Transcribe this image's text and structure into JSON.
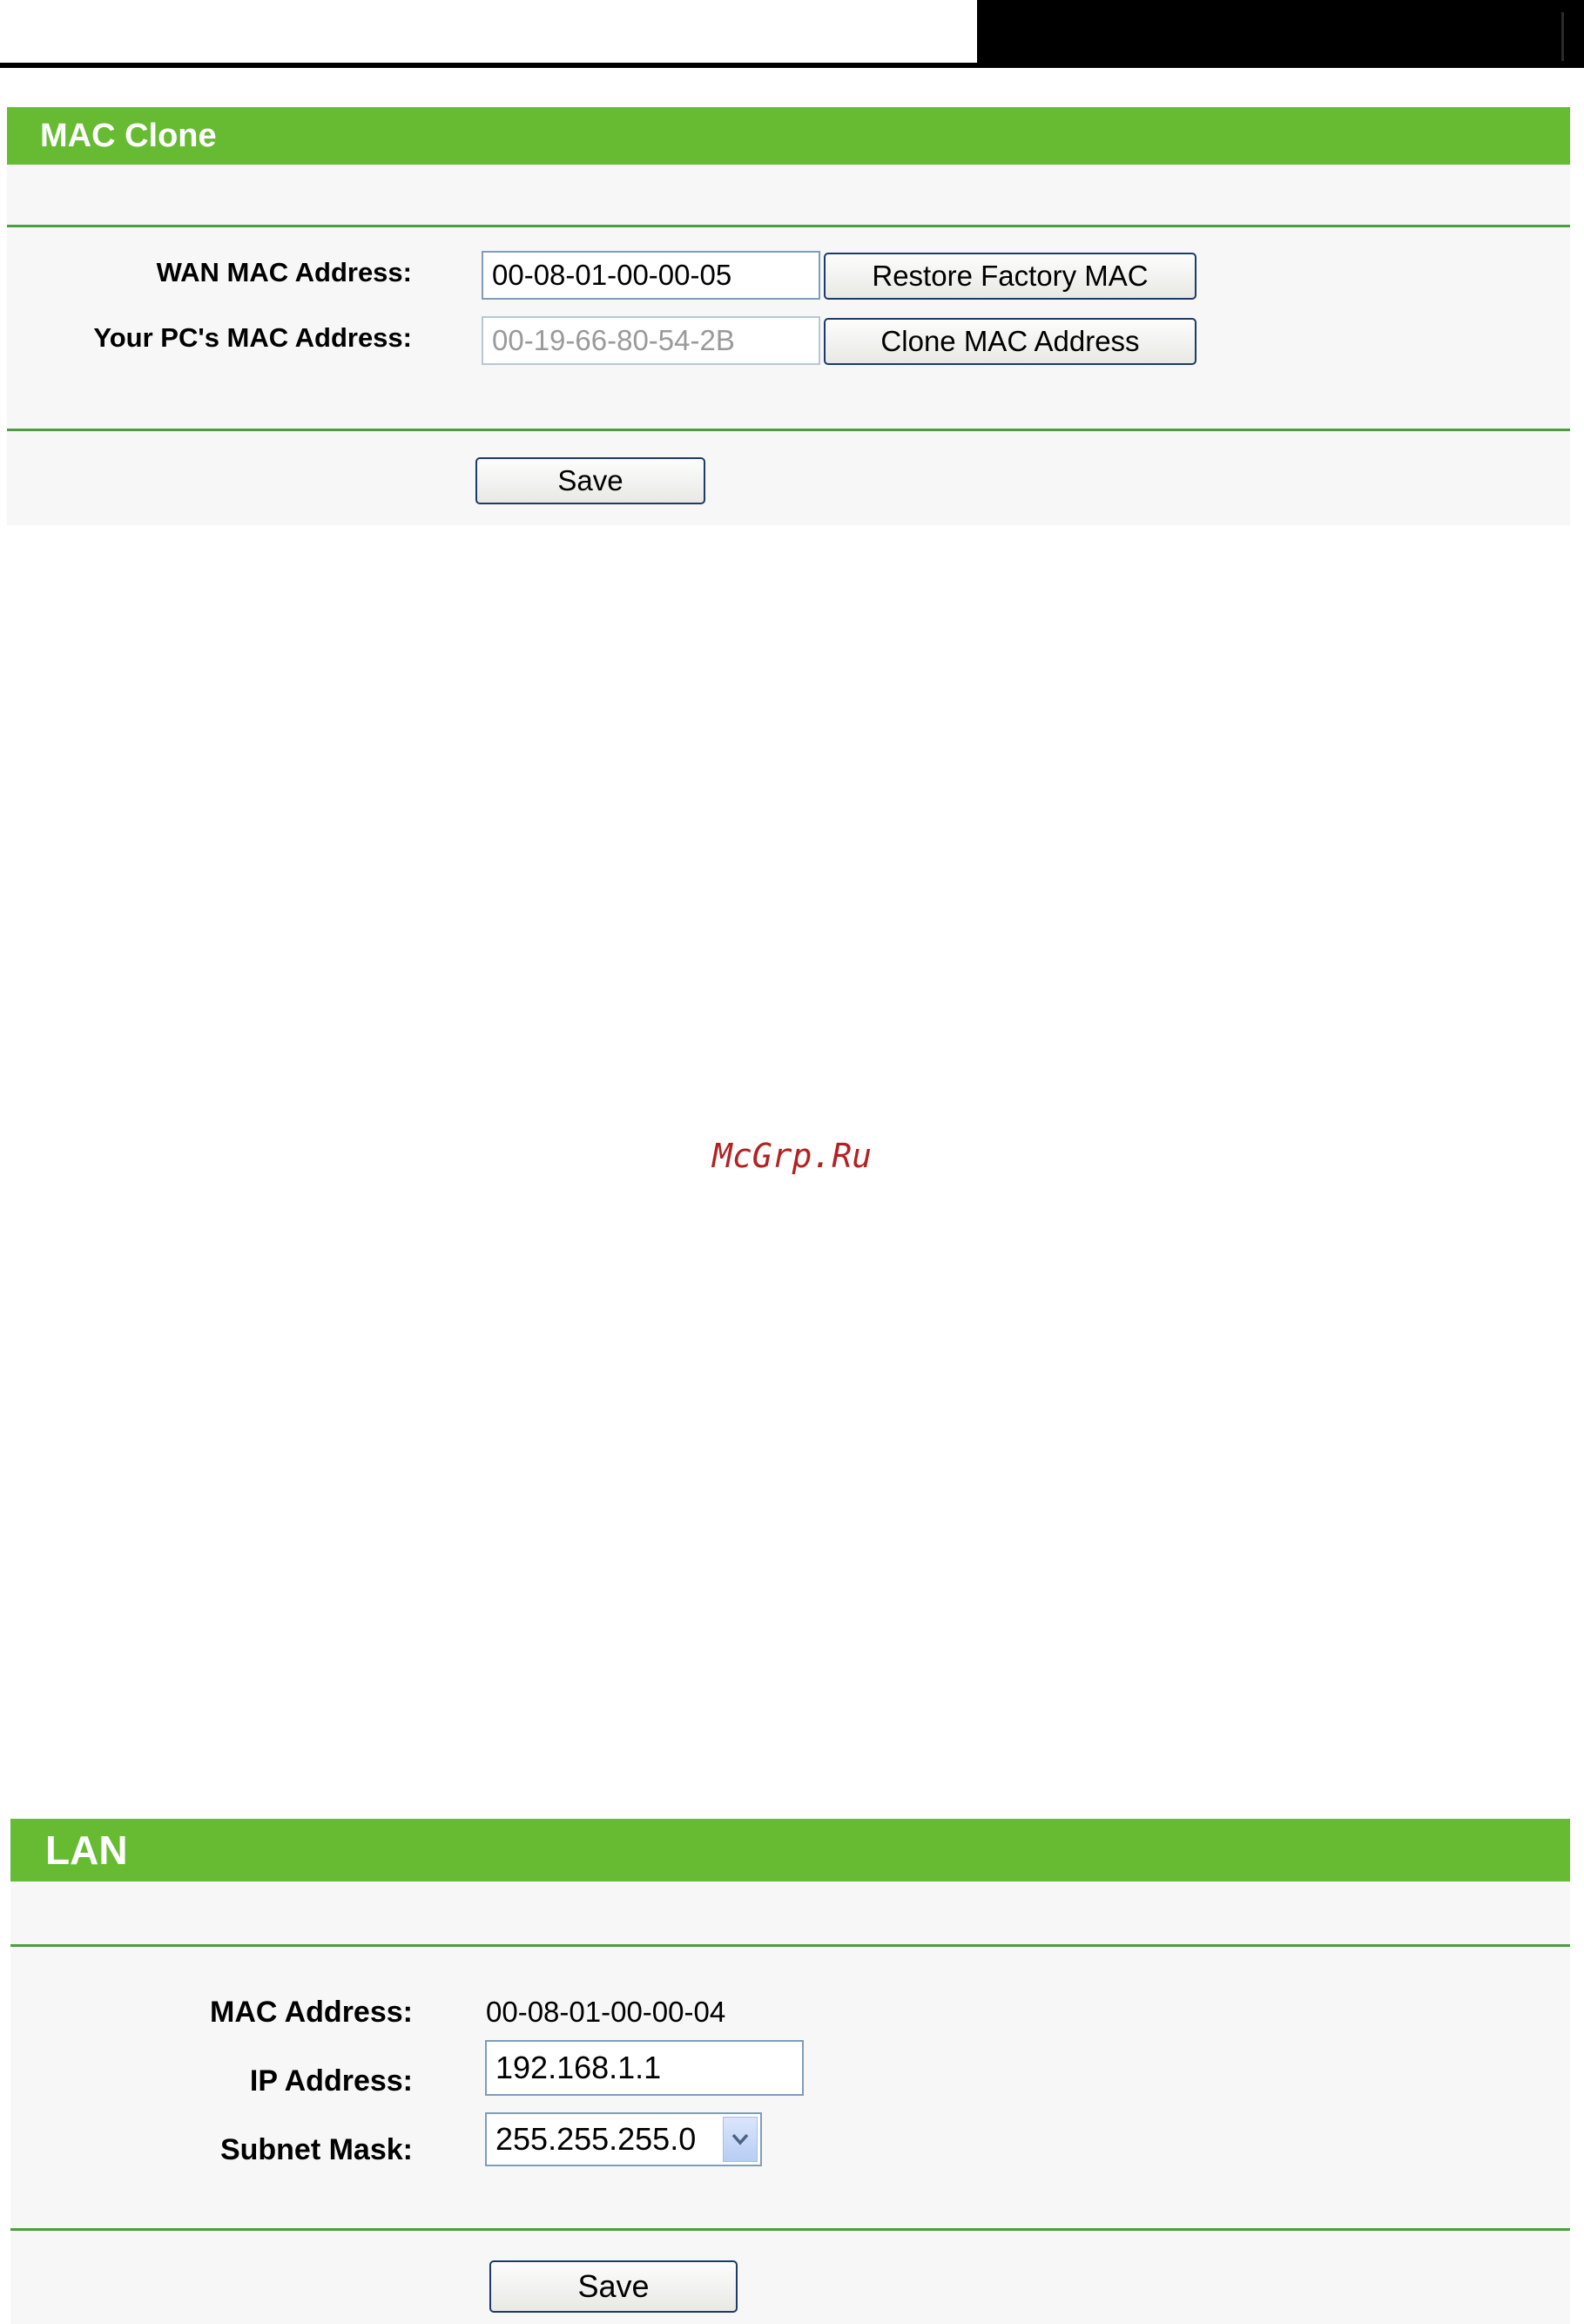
{
  "mac_clone": {
    "title": "MAC Clone",
    "wan_mac_label": "WAN MAC Address:",
    "wan_mac_value": "00-08-01-00-00-05",
    "restore_button": "Restore Factory MAC",
    "pc_mac_label": "Your PC's MAC Address:",
    "pc_mac_value": "00-19-66-80-54-2B",
    "clone_button": "Clone MAC Address",
    "save_button": "Save"
  },
  "watermark": "McGrp.Ru",
  "lan": {
    "title": "LAN",
    "mac_label": "MAC Address:",
    "mac_value": "00-08-01-00-00-04",
    "ip_label": "IP Address:",
    "ip_value": "192.168.1.1",
    "subnet_label": "Subnet Mask:",
    "subnet_value": "255.255.255.0",
    "save_button": "Save"
  },
  "colors": {
    "header_green": "#66bb33",
    "divider_green": "#4a9e40",
    "panel_bg": "#f7f7f7",
    "watermark_red": "#b22222"
  }
}
